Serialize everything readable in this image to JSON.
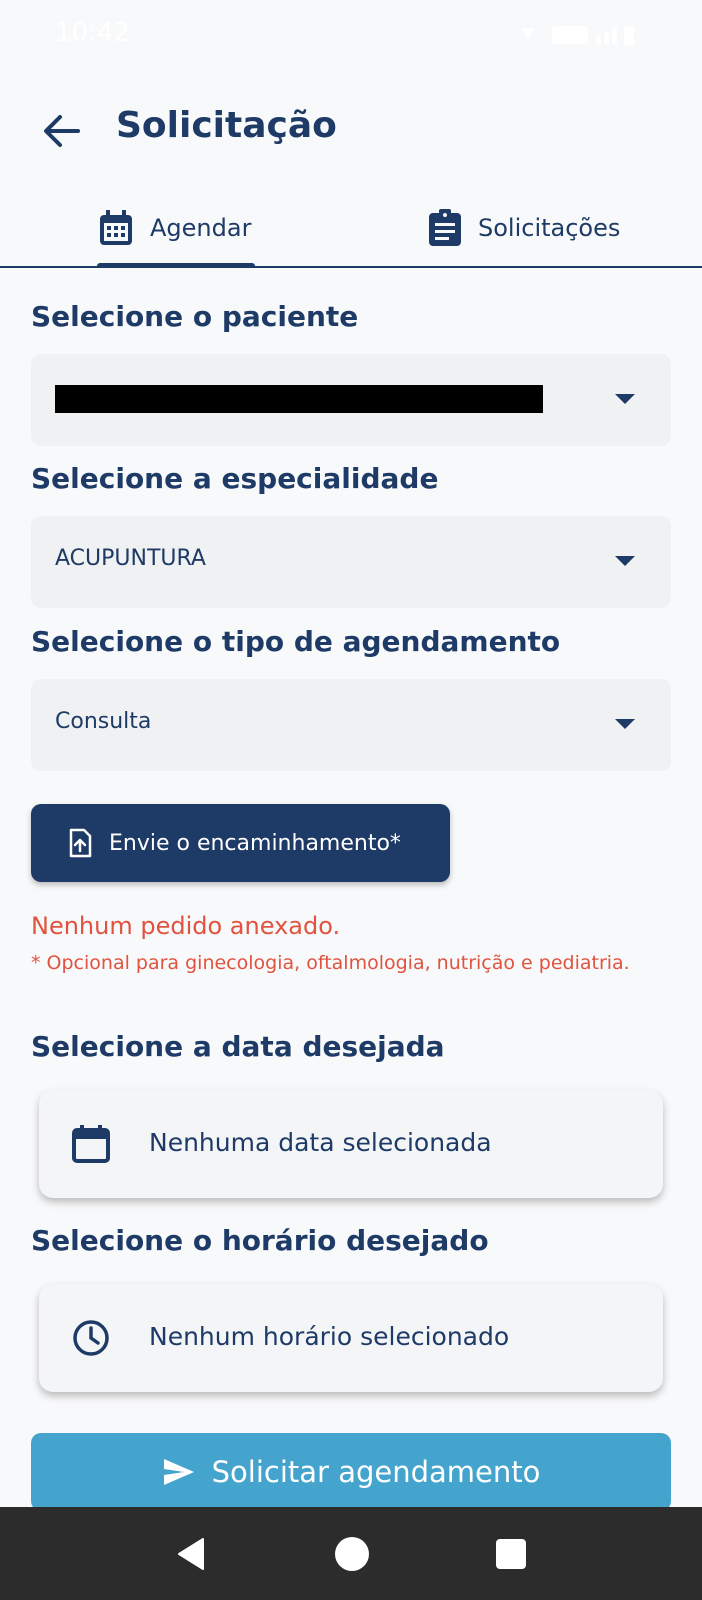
{
  "status_bar": {
    "time": "10:42"
  },
  "header": {
    "title": "Solicitação"
  },
  "tabs": [
    {
      "label": "Agendar",
      "icon": "calendar-icon",
      "selected": true
    },
    {
      "label": "Solicitações",
      "icon": "clipboard-icon",
      "selected": false
    }
  ],
  "form": {
    "patient": {
      "label": "Selecione o paciente"
    },
    "specialty": {
      "label": "Selecione a especialidade",
      "value": "ACUPUNTURA"
    },
    "appointment_type": {
      "label": "Selecione o tipo de agendamento",
      "value": "Consulta"
    },
    "upload": {
      "label": "Envie o encaminhamento*"
    },
    "error": "Nenhum pedido anexado.",
    "hint": "* Opcional para ginecologia, oftalmologia, nutrição e pediatria.",
    "date": {
      "label": "Selecione a data desejada",
      "value": "Nenhuma data selecionada"
    },
    "time": {
      "label": "Selecione o horário desejado",
      "value": "Nenhum horário selecionado"
    },
    "submit": {
      "label": "Solicitar agendamento"
    }
  },
  "colors": {
    "primary": "#1e3a66",
    "submit": "#45a4cd",
    "error": "#e0533f",
    "background": "#f8f9fa"
  }
}
